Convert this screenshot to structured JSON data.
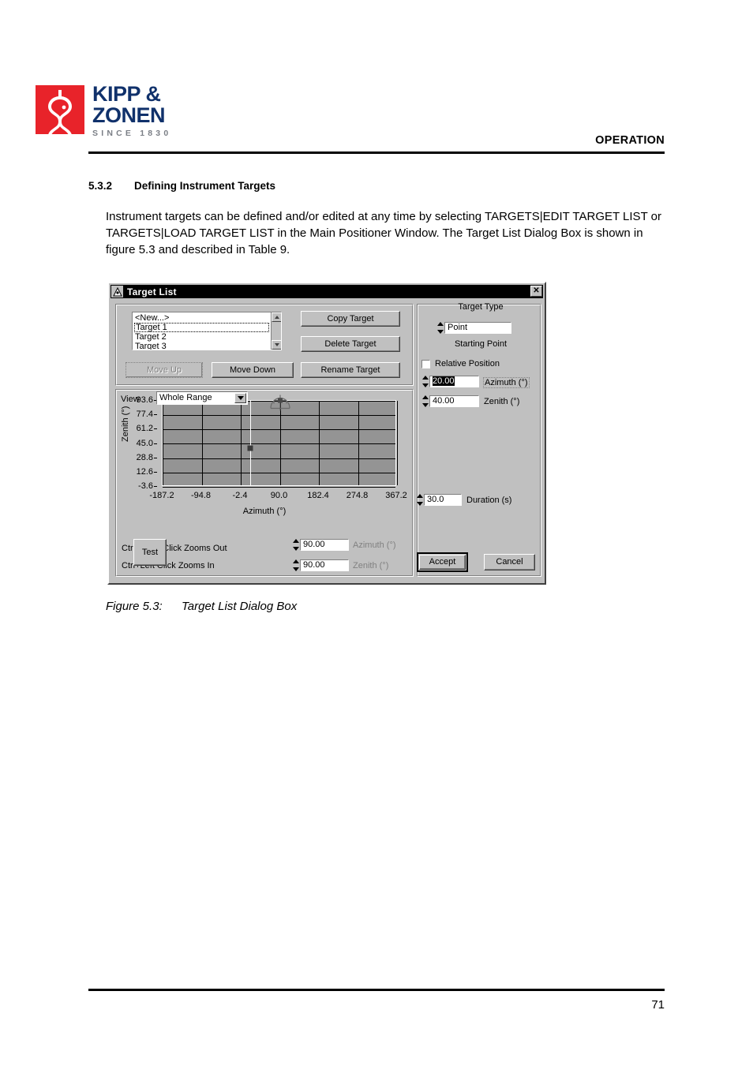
{
  "brand": {
    "name_line1": "KIPP &",
    "name_line2": "ZONEN",
    "since": "SINCE 1830",
    "logo_red": "#e8232a",
    "logo_blue": "#10316b"
  },
  "page": {
    "header_right": "OPERATION",
    "page_number": "71",
    "section_number": "5.3.2",
    "section_title": "Defining Instrument Targets",
    "paragraph": "Instrument targets can be defined and/or edited at any time by selecting TARGETS|EDIT TARGET LIST or TARGETS|LOAD TARGET LIST in the Main Positioner Window. The Target List Dialog Box is shown in figure 5.3 and described in Table 9.",
    "figure_caption_number": "Figure 5.3:",
    "figure_caption_text": "Target List Dialog Box"
  },
  "dialog": {
    "title": "Target List",
    "close_label": "✕",
    "list": {
      "items": [
        {
          "label": "<New...>",
          "focused": false
        },
        {
          "label": "Target 1",
          "focused": true
        },
        {
          "label": "Target 2",
          "focused": false
        },
        {
          "label": "Target 3",
          "focused": false
        }
      ]
    },
    "buttons": {
      "copy_target": "Copy Target",
      "delete_target": "Delete Target",
      "rename_target": "Rename Target",
      "move_up": "Move Up",
      "move_down": "Move Down",
      "test": "Test",
      "accept": "Accept",
      "cancel": "Cancel"
    },
    "view": {
      "label": "View",
      "value": "Whole Range"
    },
    "hints": {
      "zoom_out": "Ctrl+Right Click Zooms Out",
      "zoom_in": "Ctrl+Left Click Zooms In"
    },
    "cursor_fields": {
      "azimuth_value": "90.00",
      "azimuth_unit": "Azimuth (°)",
      "zenith_value": "90.00",
      "zenith_unit": "Zenith (°)"
    },
    "right_panel": {
      "target_type_label": "Target Type",
      "target_type_value": "Point",
      "starting_point_label": "Starting Point",
      "relative_position_label": "Relative Position",
      "relative_position_checked": false,
      "azimuth_value": "20.00",
      "azimuth_unit": "Azimuth (°)",
      "azimuth_selected": true,
      "zenith_value": "40.00",
      "zenith_unit": "Zenith (°)",
      "duration_value": "30.0",
      "duration_unit": "Duration (s)"
    }
  },
  "chart_data": {
    "type": "scatter",
    "title": "",
    "xlabel": "Azimuth (°)",
    "ylabel": "Zenith (°)",
    "xticks": [
      "-187.2",
      "-94.8",
      "-2.4",
      "90.0",
      "182.4",
      "274.8",
      "367.2"
    ],
    "yticks": [
      "93.6",
      "77.4",
      "61.2",
      "45.0",
      "28.8",
      "12.6",
      "-3.6"
    ],
    "xlim": [
      -187.2,
      367.2
    ],
    "ylim": [
      -3.6,
      93.6
    ],
    "grid": true,
    "legend": "none",
    "plot_bg": "#949494",
    "gridline_color": "#000000",
    "points": [
      {
        "name": "target-marker",
        "azimuth": 20.0,
        "zenith": 40.0,
        "shape": "square",
        "color": "#3a3a3a"
      },
      {
        "name": "sun-dome-indicator",
        "azimuth": 90.0,
        "zenith": 90.0,
        "shape": "dome",
        "color": "#6a6a6a"
      }
    ],
    "cursor_line_azimuth": 20.0
  }
}
